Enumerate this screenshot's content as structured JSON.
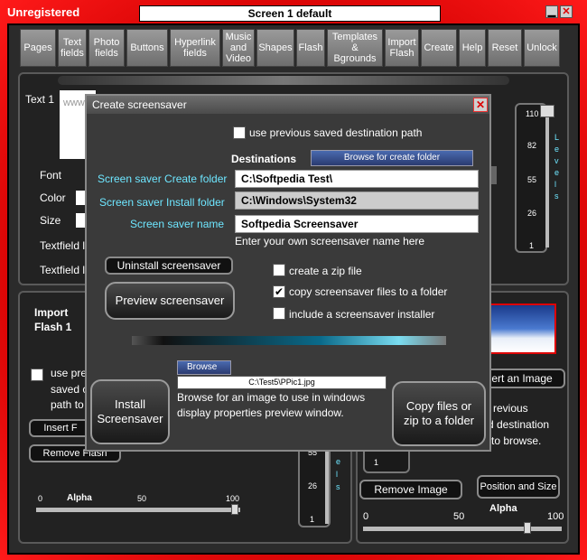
{
  "window": {
    "registration": "Unregistered",
    "screen_title": "Screen 1 default",
    "minimize": "▁",
    "close": "✕"
  },
  "toolbar": [
    "Pages",
    "Text fields",
    "Photo fields",
    "Buttons",
    "Hyperlink fields",
    "Music and Video",
    "Shapes",
    "Flash",
    "Templates & Bgrounds",
    "Import Flash",
    "Create",
    "Help",
    "Reset",
    "Unlock"
  ],
  "text_panel": {
    "text_label": "Text 1",
    "watermark": "www.softpedia.com",
    "font_label": "Font",
    "color_label": "Color",
    "size_label": "Size",
    "textfield1": "Textfield l",
    "textfield2": "Textfield l"
  },
  "right_level": {
    "ticks": [
      "110",
      "82",
      "55",
      "26",
      "1"
    ],
    "label": "L e v e l s"
  },
  "flash_panel": {
    "title": "Import Flash 1",
    "use_prev": "use pre",
    "saved": "saved c",
    "path_to": "path to",
    "insert_btn": "Insert F",
    "remove_btn": "Remove Flash",
    "alpha_label": "Alpha",
    "alpha_ticks": [
      "0",
      "50",
      "100"
    ]
  },
  "image_panel": {
    "insert_btn": "ert an Image",
    "text1": "revious",
    "text2": "d destination",
    "text3": "to browse.",
    "remove_btn": "Remove Image",
    "pos_btn": "Position and Size",
    "alpha_label": "Alpha",
    "alpha_ticks": [
      "0",
      "50",
      "100"
    ],
    "left_slider_ticks": [
      "1"
    ]
  },
  "mid_slider": {
    "ticks": [
      "55",
      "26",
      "1"
    ],
    "label": "e l s"
  },
  "dialog": {
    "title": "Create screensaver",
    "close": "✕",
    "use_prev_label": "use previous saved destination path",
    "destinations_label": "Destinations",
    "browse_folder_btn": "Browse for create folder",
    "create_folder_label": "Screen saver Create folder",
    "create_folder_value": "C:\\Softpedia Test\\",
    "install_folder_label": "Screen saver Install folder",
    "install_folder_value": "C:\\Windows\\System32",
    "name_label": "Screen saver name",
    "name_value": "Softpedia Screensaver",
    "name_hint": "Enter your own screensaver name here",
    "uninstall_btn": "Uninstall screensaver",
    "preview_btn": "Preview screensaver",
    "zip_label": "create a zip file",
    "copy_label": "copy screensaver files to a folder",
    "installer_label": "include a screensaver installer",
    "copy_check": "✔",
    "browse_btn": "Browse",
    "image_path": "C:\\Test5\\PPic1.jpg",
    "browse_hint": "Browse for an image to use in windows display properties preview window.",
    "install_btn": "Install Screensaver",
    "copy_btn": "Copy files or zip to a folder"
  },
  "colors": {
    "frame": "#d00000",
    "cyan_label": "#6ee6ff",
    "dialog_bg": "#3a3a3a"
  }
}
